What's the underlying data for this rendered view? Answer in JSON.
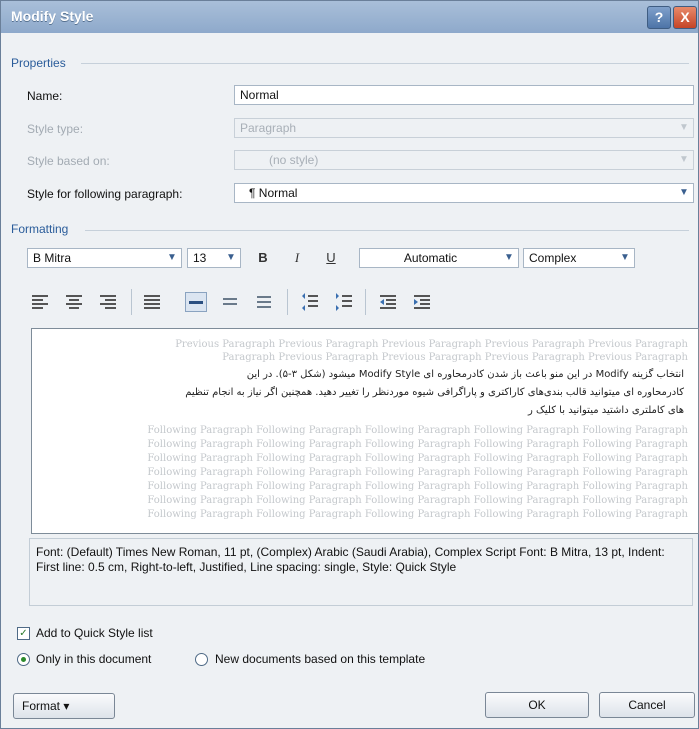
{
  "window": {
    "title": "Modify Style",
    "help": "?",
    "close": "X"
  },
  "properties": {
    "header": "Properties",
    "name_label": "Name:",
    "name_value": "Normal",
    "style_type_label": "Style type:",
    "style_type_value": "Paragraph",
    "based_on_label": "Style based on:",
    "based_on_value": "(no style)",
    "following_label": "Style for following paragraph:",
    "following_value": "¶ Normal"
  },
  "formatting": {
    "header": "Formatting",
    "font": "B Mitra",
    "size": "13",
    "bold": "B",
    "italic": "I",
    "underline": "U",
    "color": "Automatic",
    "script": "Complex"
  },
  "preview": {
    "previous_lines": [
      "Previous Paragraph Previous Paragraph Previous Paragraph Previous Paragraph Previous Paragraph",
      "Paragraph Previous Paragraph Previous Paragraph Previous Paragraph Previous Paragraph"
    ],
    "sample_lines": [
      "انتخاب گزینه Modify در این منو باعث باز شدن کادرمحاوره ای Modify Style میشود (شکل ۳-۵). در این",
      "کادرمحاوره ای میتوانید قالب بندی‌های کاراکتری و پاراگرافی شیوه موردنظر را تغییر دهید. همچنین اگر نیاز به انجام تنظیم‌",
      "های کاملتری داشتید میتوانید با کلیک ر"
    ],
    "following_lines": [
      "Following Paragraph Following Paragraph Following Paragraph Following Paragraph Following Paragraph",
      "Following Paragraph Following Paragraph Following Paragraph Following Paragraph Following Paragraph",
      "Following Paragraph Following Paragraph Following Paragraph Following Paragraph Following Paragraph",
      "Following Paragraph Following Paragraph Following Paragraph Following Paragraph Following Paragraph",
      "Following Paragraph Following Paragraph Following Paragraph Following Paragraph Following Paragraph",
      "Following Paragraph Following Paragraph Following Paragraph Following Paragraph Following Paragraph",
      "Following Paragraph Following Paragraph Following Paragraph Following Paragraph Following Paragraph"
    ]
  },
  "description": "Font: (Default) Times New Roman, 11 pt, (Complex) Arabic (Saudi Arabia), Complex Script Font: B Mitra, 13 pt, Indent: First line:  0.5 cm, Right-to-left, Justified, Line spacing:  single, Style: Quick Style",
  "options": {
    "add_quick_style": "Add to Quick Style list",
    "only_this_doc": "Only in this document",
    "new_docs": "New documents based on this template"
  },
  "buttons": {
    "format": "Format ▾",
    "ok": "OK",
    "cancel": "Cancel"
  }
}
